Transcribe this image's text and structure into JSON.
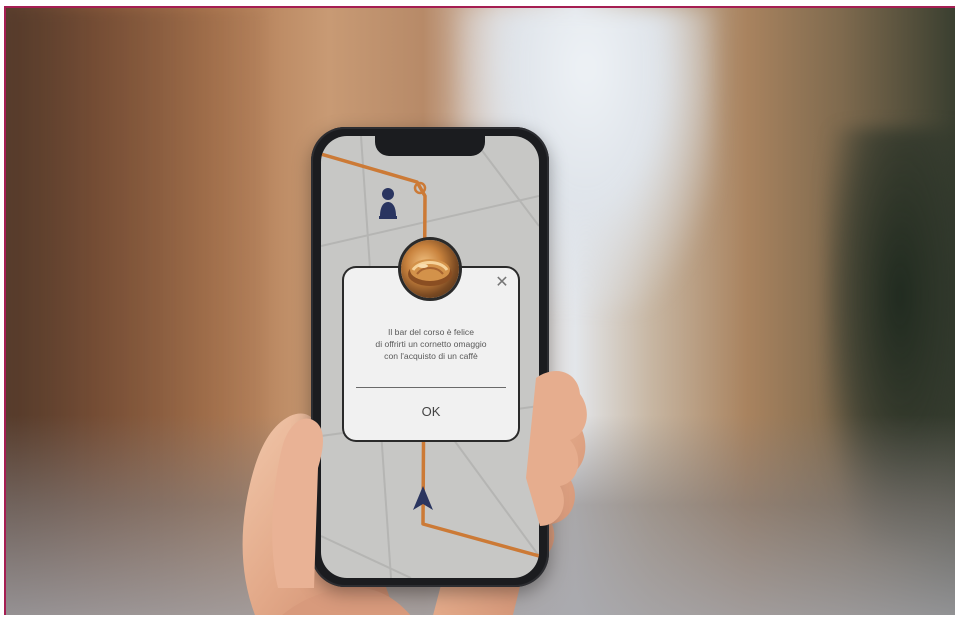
{
  "dialog": {
    "message": "Il bar del corso è felice\ndi offrirti un cornetto omaggio\ncon l'acquisto di un caffè",
    "ok_label": "OK",
    "close_symbol": "✕",
    "photo_icon": "croissant-photo"
  },
  "map": {
    "route_color": "#cc7a36",
    "background_color": "#c7c7c5",
    "user_marker_icon": "navigation-arrow-icon",
    "poi_icon": "person-pin-icon"
  },
  "colors": {
    "frame_border": "#a51e52",
    "dialog_border": "#2a2a2a"
  }
}
